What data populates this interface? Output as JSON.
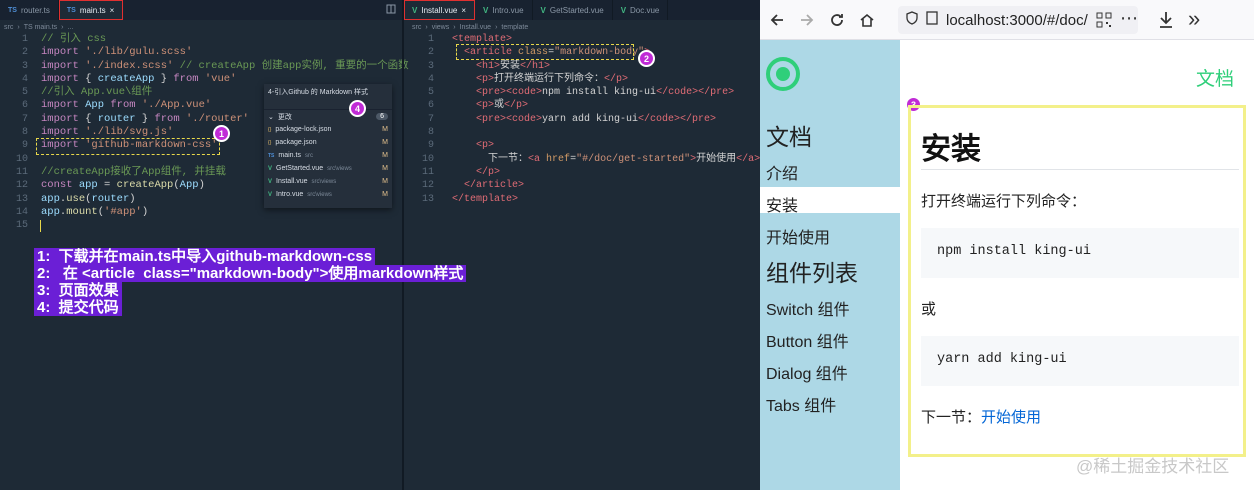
{
  "left_editor": {
    "tabs": [
      {
        "icon": "ts",
        "label": "router.ts",
        "active": false
      },
      {
        "icon": "ts",
        "label": "main.ts",
        "active": true
      }
    ],
    "close_glyph": "×",
    "breadcrumb": [
      "src",
      "TS main.ts",
      "..."
    ],
    "line_numbers": "1\n2\n3\n4\n5\n6\n7\n8\n9\n10\n11\n12\n13\n14\n15",
    "badge1": "1",
    "badge4": "4",
    "scm": {
      "title": "4-引入Github 的 Markdown 样式",
      "section": "更改",
      "count": "6",
      "files": [
        {
          "icon": "json",
          "name": "package-lock.json",
          "path": "",
          "status": "M"
        },
        {
          "icon": "json",
          "name": "package.json",
          "path": "",
          "status": "M"
        },
        {
          "icon": "ts",
          "name": "main.ts",
          "path": "src",
          "status": "M"
        },
        {
          "icon": "vue",
          "name": "GetStarted.vue",
          "path": "src\\views",
          "status": "M"
        },
        {
          "icon": "vue",
          "name": "Install.vue",
          "path": "src\\views",
          "status": "M"
        },
        {
          "icon": "vue",
          "name": "Intro.vue",
          "path": "src\\views",
          "status": "M"
        }
      ]
    }
  },
  "right_editor": {
    "tabs": [
      {
        "icon": "vue",
        "label": "Install.vue",
        "active": true
      },
      {
        "icon": "vue",
        "label": "Intro.vue",
        "active": false
      },
      {
        "icon": "vue",
        "label": "GetStarted.vue",
        "active": false
      },
      {
        "icon": "vue",
        "label": "Doc.vue",
        "active": false
      }
    ],
    "breadcrumb": [
      "src",
      "views",
      "Install.vue",
      "template"
    ],
    "line_numbers": "1\n2\n3\n4\n5\n6\n7\n8\n9\n10\n11\n12\n13",
    "badge2": "2"
  },
  "notes": [
    "1:  下载并在main.ts中导入github-markdown-css",
    "2:   在 <article  class=\"markdown-body\">使用markdown样式",
    "3:  页面效果",
    "4:  提交代码"
  ],
  "browser": {
    "url": "localhost:3000/#/doc/",
    "top_nav_link": "文档",
    "badge3": "3",
    "sidebar": {
      "heading_docs": "文档",
      "docs_items": [
        "介绍",
        "安装",
        "开始使用"
      ],
      "heading_components": "组件列表",
      "component_items": [
        "Switch 组件",
        "Button 组件",
        "Dialog 组件",
        "Tabs 组件"
      ],
      "selected": "安装"
    },
    "content": {
      "title": "安装",
      "intro": "打开终端运行下列命令：",
      "cmd1": "npm install king-ui",
      "or": "或",
      "cmd2": "yarn add king-ui",
      "next_label": "下一节：",
      "next_link": "开始使用"
    },
    "accent_color": "#2fcf7a",
    "sidebar_color": "#add8e6"
  },
  "watermark": "@稀土掘金技术社区"
}
